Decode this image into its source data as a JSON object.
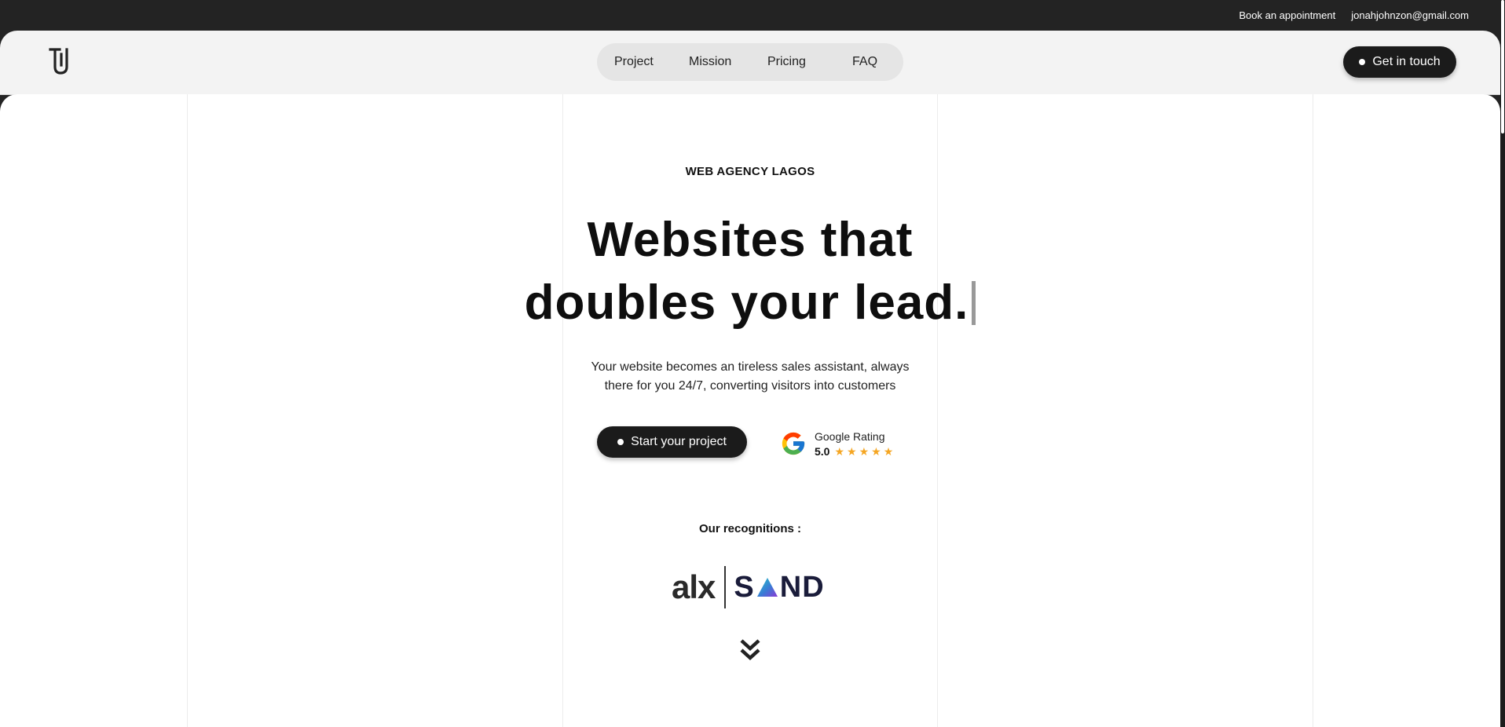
{
  "topbar": {
    "book_label": "Book an appointment",
    "email": "jonahjohnzon@gmail.com"
  },
  "header": {
    "logo_icon": "ju-monogram-logo",
    "nav": [
      {
        "label": "Project"
      },
      {
        "label": "Mission"
      },
      {
        "label": "Pricing"
      },
      {
        "label": "FAQ"
      }
    ],
    "cta_label": "Get in touch"
  },
  "hero": {
    "kicker": "WEB AGENCY LAGOS",
    "headline_line1": "Websites that",
    "headline_line2": "doubles your lead.",
    "subtitle_line1": "Your website becomes an tireless sales assistant, always",
    "subtitle_line2": "there for you 24/7, converting visitors into customers",
    "start_label": "Start your project",
    "rating": {
      "icon": "google-g-icon",
      "title": "Google Rating",
      "score": "5.0",
      "stars": 5
    },
    "recognitions_label": "Our recognitions :",
    "partners": [
      "alx",
      "SAND"
    ],
    "scroll_icon": "double-chevron-down-icon"
  },
  "colors": {
    "topbar_bg": "#232323",
    "header_bg": "#f3f3f3",
    "nav_bg": "#e5e5e5",
    "button_bg": "#1b1b1b",
    "star": "#f5a623"
  }
}
